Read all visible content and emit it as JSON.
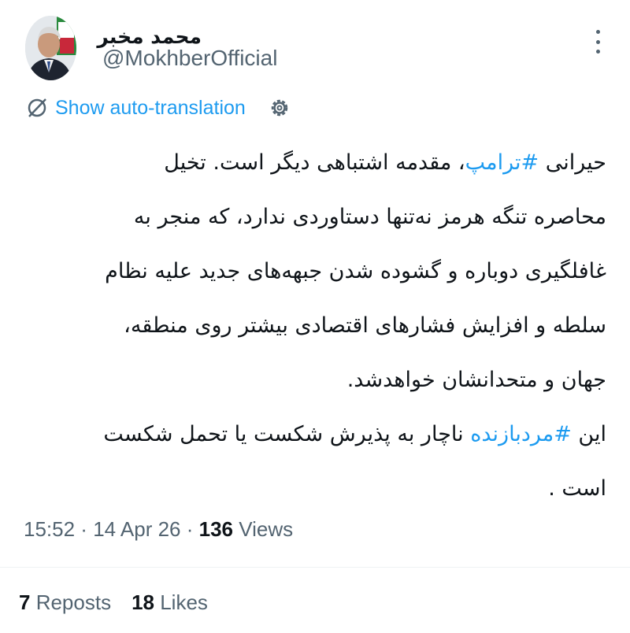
{
  "author": {
    "display_name": "محمد مخبر",
    "handle": "@MokhberOfficial"
  },
  "translation": {
    "label": "Show auto-translation"
  },
  "tweet": {
    "line1_a": "حیرانی ",
    "line1_hashtag": "#ترامپ",
    "line1_b": "، مقدمه اشتباهی دیگر است. تخیل",
    "line2": "محاصره تنگه هرمز نه‌تنها دستاوردی ندارد، که منجر به",
    "line3": "غافلگیری دوباره و گشوده شدن جبهه‌های جدید علیه نظام",
    "line4": "سلطه و افزایش فشارهای اقتصادی بیشتر روی منطقه،",
    "line5": "جهان و متحدانشان خواهدشد.",
    "line6_a": "این ",
    "line6_hashtag": "#مردبازنده",
    "line6_b": " ناچار به پذیرش شکست یا تحمل شکست",
    "line7": "است ."
  },
  "meta": {
    "time": "15:52",
    "sep1": " · ",
    "date": "14 Apr 26",
    "sep2": " · ",
    "views_count": "136",
    "views_label": " Views"
  },
  "stats": {
    "reposts_count": "7",
    "reposts_label": " Reposts",
    "likes_count": "18",
    "likes_label": " Likes"
  },
  "colors": {
    "accent": "#1d9bf0",
    "muted": "#536471",
    "text": "#0f1419"
  }
}
